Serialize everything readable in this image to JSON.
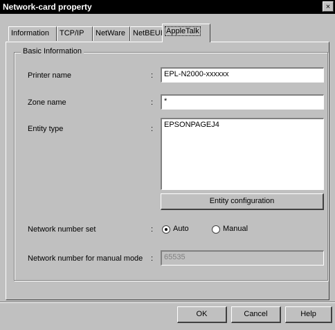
{
  "window": {
    "title": "Network-card property",
    "close_glyph": "×"
  },
  "tabs": [
    {
      "label": "Information"
    },
    {
      "label": "TCP/IP"
    },
    {
      "label": "NetWare"
    },
    {
      "label": "NetBEUI"
    },
    {
      "label": "AppleTalk"
    }
  ],
  "active_tab": "AppleTalk",
  "group": {
    "title": "Basic Information"
  },
  "colon": ":",
  "fields": {
    "printer_name": {
      "label": "Printer name",
      "value": "EPL-N2000-xxxxxx"
    },
    "zone_name": {
      "label": "Zone name",
      "value": "*"
    },
    "entity_type": {
      "label": "Entity type",
      "value": "EPSONPAGEJ4"
    }
  },
  "entity_config_button": "Entity configuration",
  "network_number_set": {
    "label": "Network number set",
    "options": [
      {
        "label": "Auto",
        "selected": true
      },
      {
        "label": "Manual",
        "selected": false
      }
    ]
  },
  "network_number_manual": {
    "label": "Network number for manual mode",
    "value": "65535"
  },
  "buttons": {
    "ok": "OK",
    "cancel": "Cancel",
    "help": "Help"
  }
}
